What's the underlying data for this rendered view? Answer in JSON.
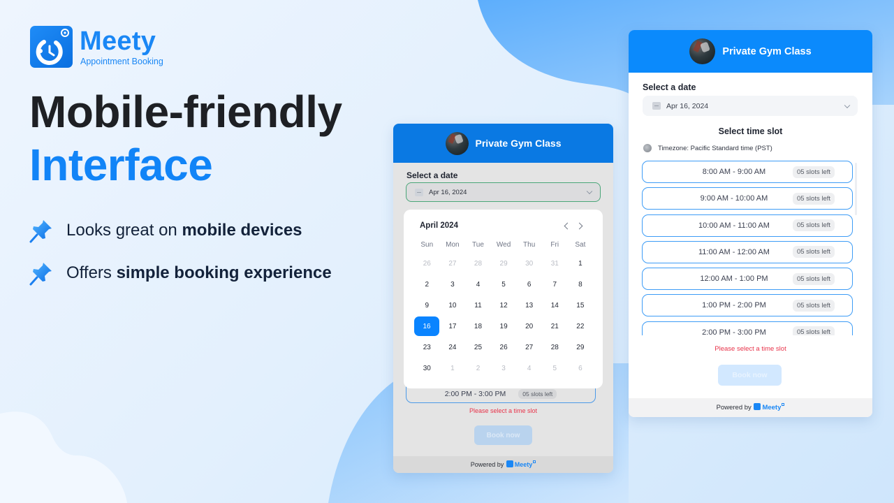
{
  "brand": {
    "name": "Meety",
    "tagline": "Appointment Booking",
    "color": "#1a87f5"
  },
  "headline": {
    "line1": "Mobile-friendly",
    "line2": "Interface",
    "line2_color": "#1184f7"
  },
  "features": [
    {
      "icon": "pushpin-icon",
      "prefix": "Looks great on ",
      "bold": "mobile devices"
    },
    {
      "icon": "pushpin-icon",
      "prefix": "Offers ",
      "bold": "simple booking experience"
    }
  ],
  "card_left": {
    "title": "Private Gym Class",
    "date_label": "Select a date",
    "date_value": "Apr 16, 2024",
    "calendar": {
      "month_label": "April 2024",
      "weekdays": [
        "Sun",
        "Mon",
        "Tue",
        "Wed",
        "Thu",
        "Fri",
        "Sat"
      ],
      "selected_day": "16",
      "days": [
        {
          "d": "26",
          "m": true
        },
        {
          "d": "27",
          "m": true
        },
        {
          "d": "28",
          "m": true
        },
        {
          "d": "29",
          "m": true
        },
        {
          "d": "30",
          "m": true
        },
        {
          "d": "31",
          "m": true
        },
        {
          "d": "1",
          "m": false
        },
        {
          "d": "2",
          "m": false
        },
        {
          "d": "3",
          "m": false
        },
        {
          "d": "4",
          "m": false
        },
        {
          "d": "5",
          "m": false
        },
        {
          "d": "6",
          "m": false
        },
        {
          "d": "7",
          "m": false
        },
        {
          "d": "8",
          "m": false
        },
        {
          "d": "9",
          "m": false
        },
        {
          "d": "10",
          "m": false
        },
        {
          "d": "11",
          "m": false
        },
        {
          "d": "12",
          "m": false
        },
        {
          "d": "13",
          "m": false
        },
        {
          "d": "14",
          "m": false
        },
        {
          "d": "15",
          "m": false
        },
        {
          "d": "16",
          "m": false
        },
        {
          "d": "17",
          "m": false
        },
        {
          "d": "18",
          "m": false
        },
        {
          "d": "19",
          "m": false
        },
        {
          "d": "20",
          "m": false
        },
        {
          "d": "21",
          "m": false
        },
        {
          "d": "22",
          "m": false
        },
        {
          "d": "23",
          "m": false
        },
        {
          "d": "24",
          "m": false
        },
        {
          "d": "25",
          "m": false
        },
        {
          "d": "26",
          "m": false
        },
        {
          "d": "27",
          "m": false
        },
        {
          "d": "28",
          "m": false
        },
        {
          "d": "29",
          "m": false
        },
        {
          "d": "30",
          "m": false
        },
        {
          "d": "1",
          "m": true
        },
        {
          "d": "2",
          "m": true
        },
        {
          "d": "3",
          "m": true
        },
        {
          "d": "4",
          "m": true
        },
        {
          "d": "5",
          "m": true
        },
        {
          "d": "6",
          "m": true
        }
      ]
    },
    "peek_slot": {
      "time": "2:00 PM - 3:00 PM",
      "badge": "05 slots left"
    },
    "error": "Please select a time slot",
    "book_label": "Book now",
    "footer": {
      "prefix": "Powered by",
      "brand": "Meety"
    }
  },
  "card_right": {
    "title": "Private Gym Class",
    "date_label": "Select a date",
    "date_value": "Apr 16, 2024",
    "slot_heading": "Select time slot",
    "timezone": "Timezone: Pacific Standard time (PST)",
    "slots": [
      {
        "time": "8:00 AM - 9:00 AM",
        "badge": "05 slots left"
      },
      {
        "time": "9:00 AM - 10:00 AM",
        "badge": "05 slots left"
      },
      {
        "time": "10:00 AM - 11:00 AM",
        "badge": "05 slots left"
      },
      {
        "time": "11:00 AM - 12:00 AM",
        "badge": "05 slots left"
      },
      {
        "time": "12:00 AM - 1:00 PM",
        "badge": "05 slots left"
      },
      {
        "time": "1:00 PM - 2:00 PM",
        "badge": "05 slots left"
      },
      {
        "time": "2:00 PM - 3:00 PM",
        "badge": "05 slots left"
      }
    ],
    "error": "Please select a time slot",
    "book_label": "Book now",
    "footer": {
      "prefix": "Powered by",
      "brand": "Meety"
    }
  },
  "colors": {
    "header_blue": "#0b8afc",
    "selected_day": "#0a84ff",
    "slot_border": "#3d9cf6",
    "error": "#e8334a"
  }
}
